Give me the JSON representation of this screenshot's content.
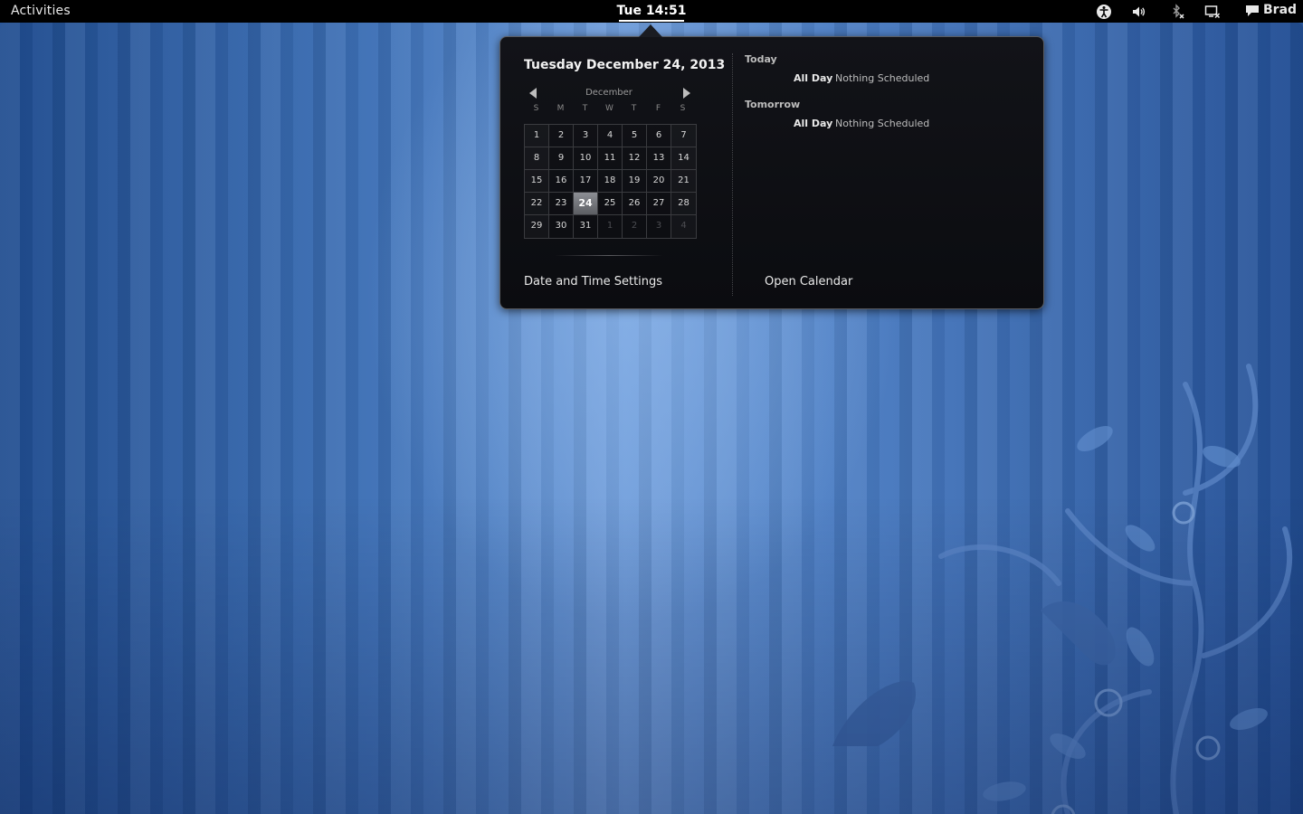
{
  "topbar": {
    "activities_label": "Activities",
    "clock_label": "Tue 14:51",
    "user_name": "Brad",
    "tray_icons": [
      "accessibility-icon",
      "volume-icon",
      "bluetooth-disabled-icon",
      "display-icon",
      "chat-bubble-icon"
    ]
  },
  "calendar": {
    "date_heading": "Tuesday December 24, 2013",
    "month": "December",
    "weekdays": [
      "S",
      "M",
      "T",
      "W",
      "T",
      "F",
      "S"
    ],
    "weeks": [
      [
        "1",
        "2",
        "3",
        "4",
        "5",
        "6",
        "7"
      ],
      [
        "8",
        "9",
        "10",
        "11",
        "12",
        "13",
        "14"
      ],
      [
        "15",
        "16",
        "17",
        "18",
        "19",
        "20",
        "21"
      ],
      [
        "22",
        "23",
        "24",
        "25",
        "26",
        "27",
        "28"
      ],
      [
        "29",
        "30",
        "31",
        "1",
        "2",
        "3",
        "4"
      ]
    ],
    "selected_day": "24",
    "settings_label": "Date and Time Settings"
  },
  "events": {
    "today": {
      "title": "Today",
      "time": "All Day",
      "desc": "Nothing Scheduled"
    },
    "tomorrow": {
      "title": "Tomorrow",
      "time": "All Day",
      "desc": "Nothing Scheduled"
    },
    "open_calendar_label": "Open Calendar"
  },
  "colors": {
    "topbar": "#000000",
    "popup_bg": "#0b0c10",
    "selected_day": "#7a7c82",
    "wallpaper": "#3f72b8"
  }
}
